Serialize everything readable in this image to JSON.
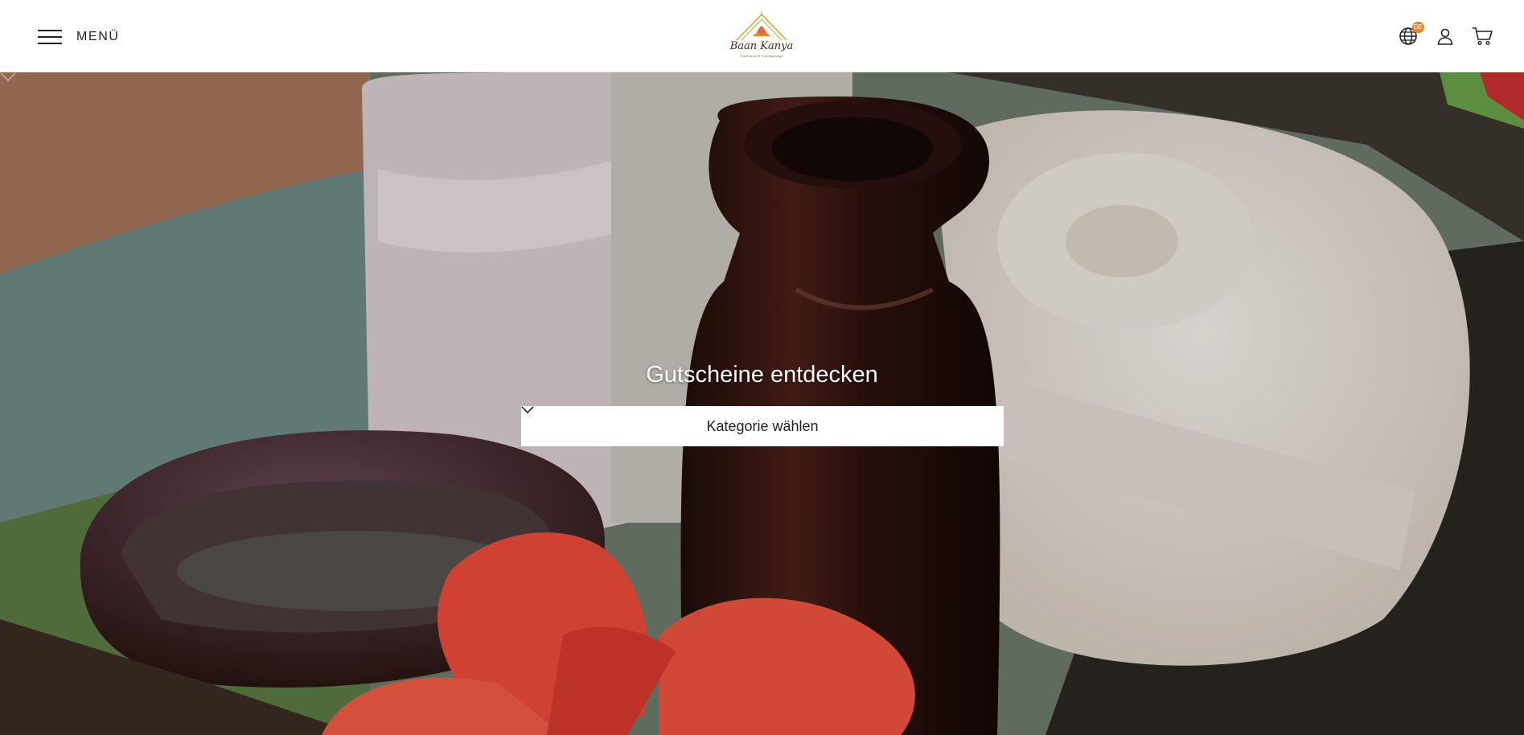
{
  "header": {
    "menu_label": "MENÜ",
    "logo": {
      "name": "Baan Kanya",
      "tagline": "Traditionelle Thaimassage"
    },
    "language_badge": "DE",
    "icons": [
      "globe-icon",
      "user-icon",
      "cart-icon"
    ]
  },
  "hero": {
    "title": "Gutscheine entdecken",
    "select": {
      "selected": "Kategorie wählen",
      "icon": "chevron-down-icon"
    }
  },
  "colors": {
    "accent": "#e8862a",
    "text": "#222222",
    "header_bg": "#ffffff"
  }
}
